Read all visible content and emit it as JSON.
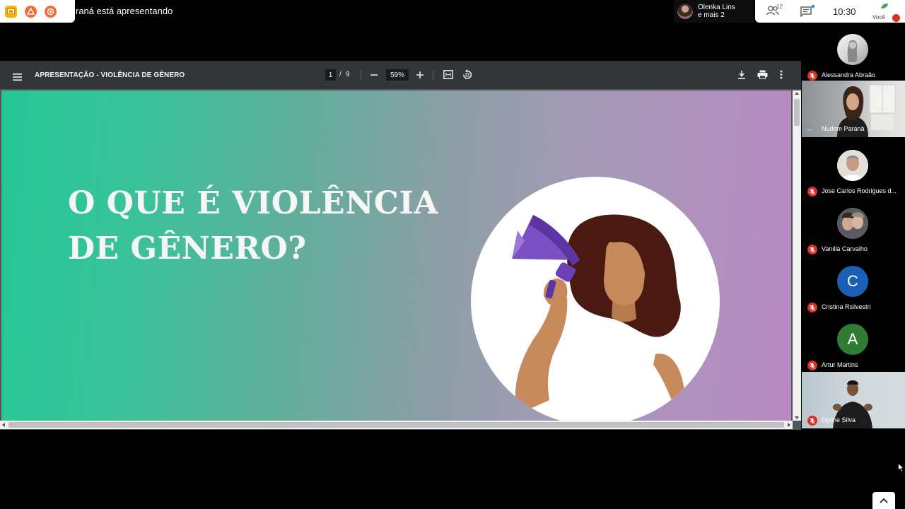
{
  "topbar": {
    "presenting_text": "raná está apresentando",
    "participants_pill": {
      "name": "Olenka Lins",
      "more": "e mais 2"
    },
    "controls": {
      "people_count": "12",
      "time": "10:30",
      "you_label": "Você"
    }
  },
  "viewer": {
    "title": "APRESENTAÇÃO - VIOLÊNCIA DE GÊNERO",
    "page_current": "1",
    "page_separator": "/",
    "page_total": "9",
    "zoom": "59%"
  },
  "slide": {
    "title_line1": "O QUE É VIOLÊNCIA",
    "title_line2": "DE GÊNERO?"
  },
  "participants": [
    {
      "name": "Alessandra Abraão",
      "type": "photo",
      "muted": true
    },
    {
      "name": "Nudem Paraná",
      "type": "video",
      "muted": false
    },
    {
      "name": "Jose Carlos Rodrigues d...",
      "type": "photo",
      "muted": true
    },
    {
      "name": "Vanilla Carvalho",
      "type": "photo",
      "muted": true
    },
    {
      "name": "Cristina Rsilvestri",
      "type": "initial",
      "initial": "C",
      "color": "#1a5fb4",
      "muted": true
    },
    {
      "name": "Artur Martins",
      "type": "initial",
      "initial": "A",
      "color": "#2e7d32",
      "muted": true
    },
    {
      "name": "Dyone Silva",
      "type": "video",
      "muted": true
    }
  ],
  "colors": {
    "slide_green": "#25c796",
    "slide_purple": "#b889c4",
    "toolbar_bg": "#323639",
    "mic_muted": "#d93025",
    "megaphone": "#7b4fc4",
    "skin": "#c68a5d",
    "hair": "#4a1a12"
  },
  "icons": {
    "menu": "hamburger-icon",
    "download": "download-icon",
    "print": "print-icon",
    "more": "more-vert-icon",
    "fit": "fit-page-icon",
    "rotate": "rotate-icon",
    "people": "people-icon",
    "chat": "chat-icon",
    "mic_off": "mic-off-icon",
    "chevron": "chevron-up-icon"
  }
}
